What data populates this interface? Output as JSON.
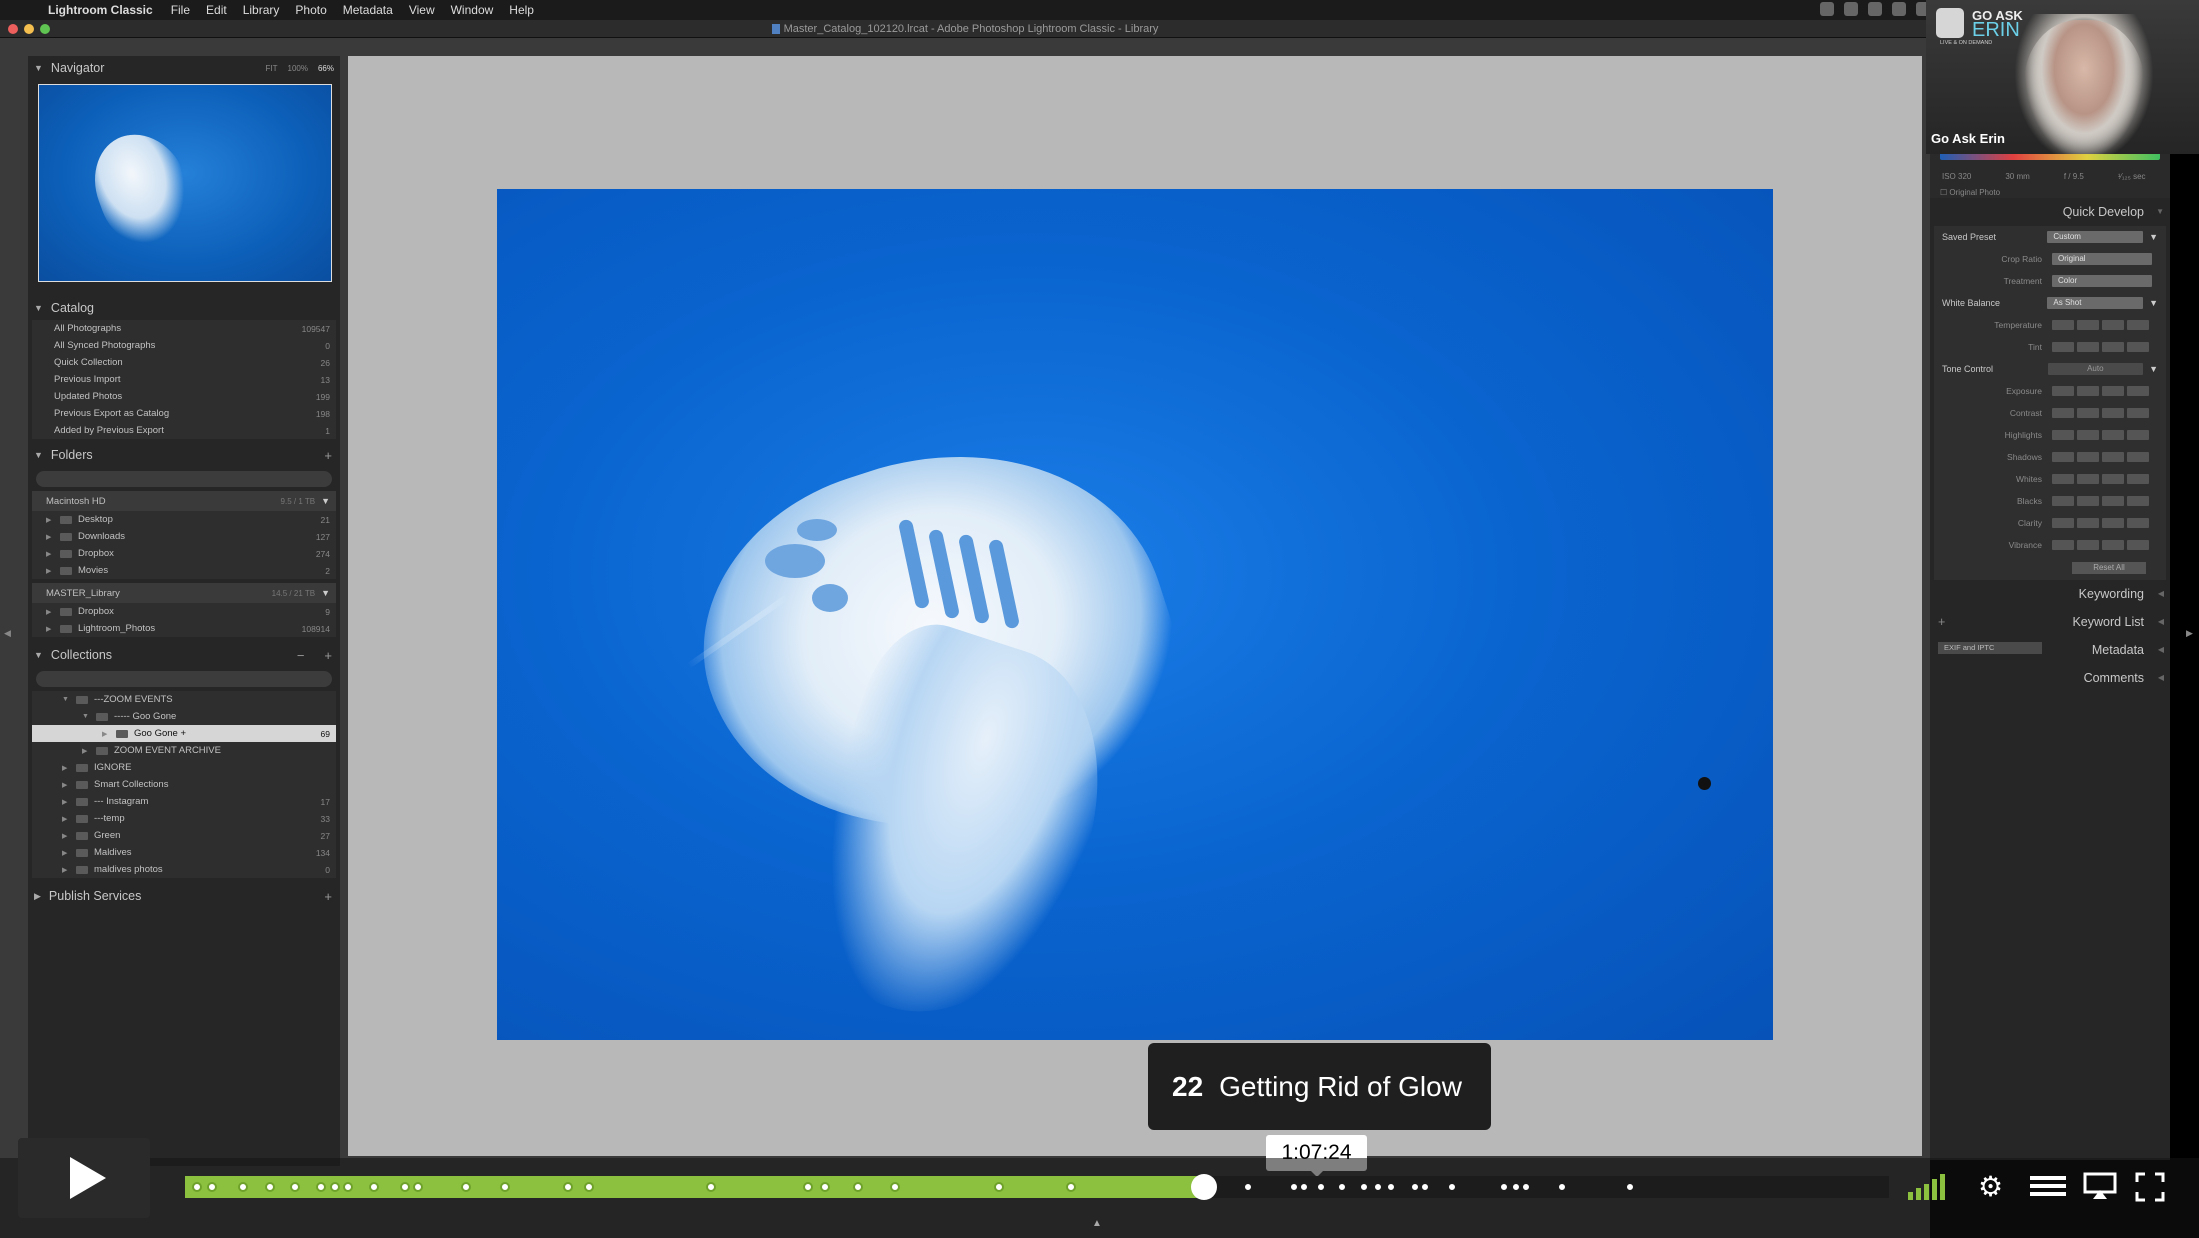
{
  "menubar": {
    "app_name": "Lightroom Classic",
    "items": [
      "File",
      "Edit",
      "Library",
      "Photo",
      "Metadata",
      "View",
      "Window",
      "Help"
    ]
  },
  "window": {
    "title": "Master_Catalog_102120.lrcat - Adobe Photoshop Lightroom Classic - Library"
  },
  "navigator": {
    "title": "Navigator",
    "zoom_options": [
      "FIT",
      "100%",
      "66%"
    ]
  },
  "catalog": {
    "title": "Catalog",
    "items": [
      {
        "label": "All Photographs",
        "count": "109547"
      },
      {
        "label": "All Synced Photographs",
        "count": "0"
      },
      {
        "label": "Quick Collection",
        "count": "26"
      },
      {
        "label": "Previous Import",
        "count": "13"
      },
      {
        "label": "Updated Photos",
        "count": "199"
      },
      {
        "label": "Previous Export as Catalog",
        "count": "198"
      },
      {
        "label": "Added by Previous Export",
        "count": "1"
      }
    ]
  },
  "folders": {
    "title": "Folders",
    "volumes": [
      {
        "name": "Macintosh HD",
        "info": "9.5 / 1 TB",
        "items": [
          {
            "label": "Desktop",
            "count": "21"
          },
          {
            "label": "Downloads",
            "count": "127"
          },
          {
            "label": "Dropbox",
            "count": "274"
          },
          {
            "label": "Movies",
            "count": "2"
          }
        ]
      },
      {
        "name": "MASTER_Library",
        "info": "14.5 / 21 TB",
        "items": [
          {
            "label": "Dropbox",
            "count": "9"
          },
          {
            "label": "Lightroom_Photos",
            "count": "108914"
          }
        ]
      }
    ]
  },
  "collections": {
    "title": "Collections",
    "items": [
      {
        "label": "---ZOOM EVENTS",
        "count": "",
        "indent": 1,
        "expand": "▼"
      },
      {
        "label": "----- Goo Gone",
        "count": "",
        "indent": 2,
        "expand": "▼"
      },
      {
        "label": "Goo Gone +",
        "count": "69",
        "indent": 3,
        "expand": "▶",
        "selected": true
      },
      {
        "label": "ZOOM EVENT ARCHIVE",
        "count": "",
        "indent": 2,
        "expand": "▶"
      },
      {
        "label": "IGNORE",
        "count": "",
        "indent": 1,
        "expand": "▶"
      },
      {
        "label": "Smart Collections",
        "count": "",
        "indent": 1,
        "expand": "▶"
      },
      {
        "label": "--- Instagram",
        "count": "17",
        "indent": 1,
        "expand": "▶"
      },
      {
        "label": "---temp",
        "count": "33",
        "indent": 1,
        "expand": "▶"
      },
      {
        "label": "Green",
        "count": "27",
        "indent": 1,
        "expand": "▶"
      },
      {
        "label": "Maldives",
        "count": "134",
        "indent": 1,
        "expand": "▶"
      },
      {
        "label": "maldives photos",
        "count": "0",
        "indent": 1,
        "expand": "▶"
      }
    ]
  },
  "publish": {
    "title": "Publish Services"
  },
  "histogram": {
    "iso": "ISO 320",
    "focal": "30 mm",
    "aperture": "f / 9.5",
    "shutter": "¹⁄₁₂₅ sec",
    "original_photo": "Original Photo"
  },
  "quick_develop": {
    "title": "Quick Develop",
    "saved_preset_label": "Saved Preset",
    "saved_preset_value": "Custom",
    "crop_ratio_label": "Crop Ratio",
    "crop_ratio_value": "Original",
    "treatment_label": "Treatment",
    "treatment_value": "Color",
    "white_balance_label": "White Balance",
    "white_balance_value": "As Shot",
    "temperature_label": "Temperature",
    "tint_label": "Tint",
    "tone_control_label": "Tone Control",
    "auto_label": "Auto",
    "exposure_label": "Exposure",
    "contrast_label": "Contrast",
    "highlights_label": "Highlights",
    "shadows_label": "Shadows",
    "whites_label": "Whites",
    "blacks_label": "Blacks",
    "clarity_label": "Clarity",
    "vibrance_label": "Vibrance",
    "reset_label": "Reset All"
  },
  "right_panels": {
    "keywording": "Keywording",
    "keyword_list": "Keyword List",
    "metadata": "Metadata",
    "metadata_preset": "EXIF and IPTC",
    "comments": "Comments"
  },
  "webcam": {
    "name": "Go Ask Erin",
    "logo_line1": "GO ASK",
    "logo_line2": "ERIN",
    "logo_line3": "LIVE & ON DEMAND"
  },
  "player": {
    "chapter_number": "22",
    "chapter_title": "Getting Rid of Glow",
    "current_time": "1:07:24",
    "progress_fraction": 0.598,
    "chapter_markers": [
      0.008,
      0.017,
      0.035,
      0.051,
      0.066,
      0.081,
      0.089,
      0.097,
      0.112,
      0.13,
      0.138,
      0.166,
      0.189,
      0.226,
      0.238,
      0.31,
      0.367,
      0.377,
      0.396,
      0.418,
      0.479,
      0.521,
      0.625,
      0.652,
      0.658,
      0.668,
      0.68,
      0.693,
      0.701,
      0.709,
      0.723,
      0.729,
      0.745,
      0.775,
      0.782,
      0.788,
      0.809,
      0.849
    ]
  }
}
